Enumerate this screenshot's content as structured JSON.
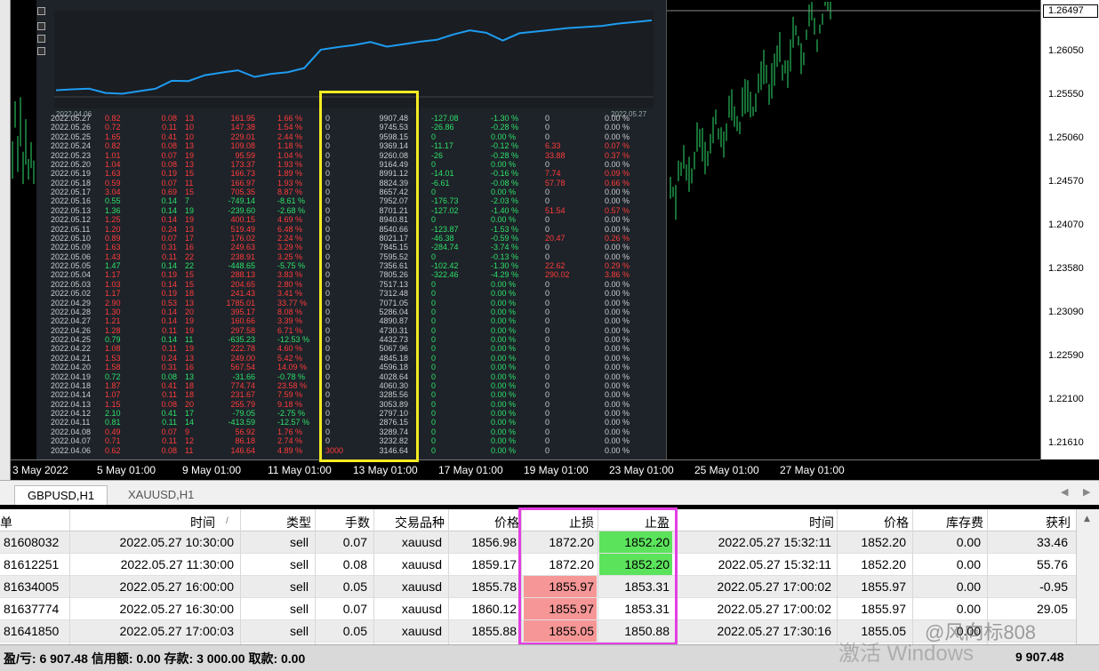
{
  "price_axis": {
    "current": "1.26497",
    "ticks": [
      "1.26050",
      "1.25550",
      "1.25060",
      "1.24570",
      "1.24070",
      "1.23580",
      "1.23090",
      "1.22590",
      "1.22100",
      "1.21610"
    ]
  },
  "time_axis": {
    "ticks": [
      "3 May 2022",
      "5 May 01:00",
      "9 May 01:00",
      "11 May 01:00",
      "13 May 01:00",
      "17 May 01:00",
      "19 May 01:00",
      "23 May 01:00",
      "25 May 01:00",
      "27 May 01:00"
    ]
  },
  "report": {
    "equity_start_date": "2022.04.06",
    "equity_end_date": "2022.05.27",
    "rows": [
      {
        "date": "2022.05.27",
        "a": "0.82",
        "b": "0.08",
        "c": "13",
        "d": "161.95",
        "e": "1.66 %",
        "f": "0",
        "g": "9907.48",
        "h": "-127.08",
        "i": "-1.30 %",
        "j": "0",
        "k": "0.00 %",
        "pos": false
      },
      {
        "date": "2022.05.26",
        "a": "0.72",
        "b": "0.11",
        "c": "10",
        "d": "147.38",
        "e": "1.54 %",
        "f": "0",
        "g": "9745.53",
        "h": "-26.86",
        "i": "-0.28 %",
        "j": "0",
        "k": "0.00 %",
        "pos": false
      },
      {
        "date": "2022.05.25",
        "a": "1.65",
        "b": "0.41",
        "c": "10",
        "d": "229.01",
        "e": "2.44 %",
        "f": "0",
        "g": "9598.15",
        "h": "0",
        "i": "0.00 %",
        "j": "0",
        "k": "0.00 %",
        "pos": false
      },
      {
        "date": "2022.05.24",
        "a": "0.82",
        "b": "0.08",
        "c": "13",
        "d": "109.08",
        "e": "1.18 %",
        "f": "0",
        "g": "9369.14",
        "h": "-11.17",
        "i": "-0.12 %",
        "j": "6.33",
        "k": "0.07 %",
        "pos": false
      },
      {
        "date": "2022.05.23",
        "a": "1.01",
        "b": "0.07",
        "c": "19",
        "d": "95.59",
        "e": "1.04 %",
        "f": "0",
        "g": "9260.08",
        "h": "-26",
        "i": "-0.28 %",
        "j": "33.88",
        "k": "0.37 %",
        "pos": false
      },
      {
        "date": "2022.05.20",
        "a": "1.04",
        "b": "0.08",
        "c": "13",
        "d": "173.37",
        "e": "1.93 %",
        "f": "0",
        "g": "9164.49",
        "h": "0",
        "i": "0.00 %",
        "j": "0",
        "k": "0.00 %",
        "pos": false
      },
      {
        "date": "2022.05.19",
        "a": "1.63",
        "b": "0.19",
        "c": "15",
        "d": "166.73",
        "e": "1.89 %",
        "f": "0",
        "g": "8991.12",
        "h": "-14.01",
        "i": "-0.16 %",
        "j": "7.74",
        "k": "0.09 %",
        "pos": false
      },
      {
        "date": "2022.05.18",
        "a": "0.59",
        "b": "0.07",
        "c": "11",
        "d": "166.97",
        "e": "1.93 %",
        "f": "0",
        "g": "8824.39",
        "h": "-6.61",
        "i": "-0.08 %",
        "j": "57.78",
        "k": "0.66 %",
        "pos": false
      },
      {
        "date": "2022.05.17",
        "a": "3.04",
        "b": "0.69",
        "c": "15",
        "d": "705.35",
        "e": "8.87 %",
        "f": "0",
        "g": "8657.42",
        "h": "0",
        "i": "0.00 %",
        "j": "0",
        "k": "0.00 %",
        "pos": false
      },
      {
        "date": "2022.05.16",
        "a": "0.55",
        "b": "0.14",
        "c": "7",
        "d": "-749.14",
        "e": "-8.61 %",
        "f": "0",
        "g": "7952.07",
        "h": "-176.73",
        "i": "-2.03 %",
        "j": "0",
        "k": "0.00 %",
        "pos": true
      },
      {
        "date": "2022.05.13",
        "a": "1.36",
        "b": "0.14",
        "c": "19",
        "d": "-239.60",
        "e": "-2.68 %",
        "f": "0",
        "g": "8701.21",
        "h": "-127.02",
        "i": "-1.40 %",
        "j": "51.54",
        "k": "0.57 %",
        "pos": true
      },
      {
        "date": "2022.05.12",
        "a": "1.25",
        "b": "0.14",
        "c": "19",
        "d": "400.15",
        "e": "4.69 %",
        "f": "0",
        "g": "8940.81",
        "h": "0",
        "i": "0.00 %",
        "j": "0",
        "k": "0.00 %",
        "pos": false
      },
      {
        "date": "2022.05.11",
        "a": "1.20",
        "b": "0.24",
        "c": "13",
        "d": "519.49",
        "e": "6.48 %",
        "f": "0",
        "g": "8540.66",
        "h": "-123.87",
        "i": "-1.53 %",
        "j": "0",
        "k": "0.00 %",
        "pos": false
      },
      {
        "date": "2022.05.10",
        "a": "0.89",
        "b": "0.07",
        "c": "17",
        "d": "176.02",
        "e": "2.24 %",
        "f": "0",
        "g": "8021.17",
        "h": "-46.38",
        "i": "-0.59 %",
        "j": "20.47",
        "k": "0.26 %",
        "pos": false
      },
      {
        "date": "2022.05.09",
        "a": "1.63",
        "b": "0.31",
        "c": "16",
        "d": "249.63",
        "e": "3.29 %",
        "f": "0",
        "g": "7845.15",
        "h": "-284.74",
        "i": "-3.74 %",
        "j": "0",
        "k": "0.00 %",
        "pos": false
      },
      {
        "date": "2022.05.06",
        "a": "1.43",
        "b": "0.11",
        "c": "22",
        "d": "238.91",
        "e": "3.25 %",
        "f": "0",
        "g": "7595.52",
        "h": "0",
        "i": "-0.13 %",
        "j": "0",
        "k": "0.00 %",
        "pos": false
      },
      {
        "date": "2022.05.05",
        "a": "1.47",
        "b": "0.14",
        "c": "22",
        "d": "-448.65",
        "e": "-5.75 %",
        "f": "0",
        "g": "7356.61",
        "h": "-102.42",
        "i": "-1.30 %",
        "j": "22.62",
        "k": "0.29 %",
        "pos": true
      },
      {
        "date": "2022.05.04",
        "a": "1.17",
        "b": "0.19",
        "c": "15",
        "d": "288.13",
        "e": "3.83 %",
        "f": "0",
        "g": "7805.26",
        "h": "-322.46",
        "i": "-4.29 %",
        "j": "290.02",
        "k": "3.86 %",
        "pos": false
      },
      {
        "date": "2022.05.03",
        "a": "1.03",
        "b": "0.14",
        "c": "15",
        "d": "204.65",
        "e": "2.80 %",
        "f": "0",
        "g": "7517.13",
        "h": "0",
        "i": "0.00 %",
        "j": "0",
        "k": "0.00 %",
        "pos": false
      },
      {
        "date": "2022.05.02",
        "a": "1.17",
        "b": "0.19",
        "c": "18",
        "d": "241.43",
        "e": "3.41 %",
        "f": "0",
        "g": "7312.48",
        "h": "0",
        "i": "0.00 %",
        "j": "0",
        "k": "0.00 %",
        "pos": false
      },
      {
        "date": "2022.04.29",
        "a": "2.90",
        "b": "0.53",
        "c": "13",
        "d": "1785.01",
        "e": "33.77 %",
        "f": "0",
        "g": "7071.05",
        "h": "0",
        "i": "0.00 %",
        "j": "0",
        "k": "0.00 %",
        "pos": false
      },
      {
        "date": "2022.04.28",
        "a": "1.30",
        "b": "0.14",
        "c": "20",
        "d": "395.17",
        "e": "8.08 %",
        "f": "0",
        "g": "5286.04",
        "h": "0",
        "i": "0.00 %",
        "j": "0",
        "k": "0.00 %",
        "pos": false
      },
      {
        "date": "2022.04.27",
        "a": "1.21",
        "b": "0.14",
        "c": "19",
        "d": "160.66",
        "e": "3.39 %",
        "f": "0",
        "g": "4890.87",
        "h": "0",
        "i": "0.00 %",
        "j": "0",
        "k": "0.00 %",
        "pos": false
      },
      {
        "date": "2022.04.26",
        "a": "1.28",
        "b": "0.11",
        "c": "19",
        "d": "297.58",
        "e": "6.71 %",
        "f": "0",
        "g": "4730.31",
        "h": "0",
        "i": "0.00 %",
        "j": "0",
        "k": "0.00 %",
        "pos": false
      },
      {
        "date": "2022.04.25",
        "a": "0.79",
        "b": "0.14",
        "c": "11",
        "d": "-635.23",
        "e": "-12.53 %",
        "f": "0",
        "g": "4432.73",
        "h": "0",
        "i": "0.00 %",
        "j": "0",
        "k": "0.00 %",
        "pos": true
      },
      {
        "date": "2022.04.22",
        "a": "1.08",
        "b": "0.11",
        "c": "19",
        "d": "222.78",
        "e": "4.60 %",
        "f": "0",
        "g": "5067.96",
        "h": "0",
        "i": "0.00 %",
        "j": "0",
        "k": "0.00 %",
        "pos": false
      },
      {
        "date": "2022.04.21",
        "a": "1.53",
        "b": "0.24",
        "c": "13",
        "d": "249.00",
        "e": "5.42 %",
        "f": "0",
        "g": "4845.18",
        "h": "0",
        "i": "0.00 %",
        "j": "0",
        "k": "0.00 %",
        "pos": false
      },
      {
        "date": "2022.04.20",
        "a": "1.58",
        "b": "0.31",
        "c": "16",
        "d": "567.54",
        "e": "14.09 %",
        "f": "0",
        "g": "4596.18",
        "h": "0",
        "i": "0.00 %",
        "j": "0",
        "k": "0.00 %",
        "pos": false
      },
      {
        "date": "2022.04.19",
        "a": "0.72",
        "b": "0.08",
        "c": "13",
        "d": "-31.66",
        "e": "-0.78 %",
        "f": "0",
        "g": "4028.64",
        "h": "0",
        "i": "0.00 %",
        "j": "0",
        "k": "0.00 %",
        "pos": true
      },
      {
        "date": "2022.04.18",
        "a": "1.87",
        "b": "0.41",
        "c": "18",
        "d": "774.74",
        "e": "23.58 %",
        "f": "0",
        "g": "4060.30",
        "h": "0",
        "i": "0.00 %",
        "j": "0",
        "k": "0.00 %",
        "pos": false
      },
      {
        "date": "2022.04.14",
        "a": "1.07",
        "b": "0.11",
        "c": "18",
        "d": "231.67",
        "e": "7.59 %",
        "f": "0",
        "g": "3285.56",
        "h": "0",
        "i": "0.00 %",
        "j": "0",
        "k": "0.00 %",
        "pos": false
      },
      {
        "date": "2022.04.13",
        "a": "1.15",
        "b": "0.08",
        "c": "20",
        "d": "255.79",
        "e": "9.18 %",
        "f": "0",
        "g": "3053.89",
        "h": "0",
        "i": "0.00 %",
        "j": "0",
        "k": "0.00 %",
        "pos": false
      },
      {
        "date": "2022.04.12",
        "a": "2.10",
        "b": "0.41",
        "c": "17",
        "d": "-79.05",
        "e": "-2.75 %",
        "f": "0",
        "g": "2797.10",
        "h": "0",
        "i": "0.00 %",
        "j": "0",
        "k": "0.00 %",
        "pos": true
      },
      {
        "date": "2022.04.11",
        "a": "0.81",
        "b": "0.11",
        "c": "14",
        "d": "-413.59",
        "e": "-12.57 %",
        "f": "0",
        "g": "2876.15",
        "h": "0",
        "i": "0.00 %",
        "j": "0",
        "k": "0.00 %",
        "pos": true
      },
      {
        "date": "2022.04.08",
        "a": "0.49",
        "b": "0.07",
        "c": "9",
        "d": "56.92",
        "e": "1.76 %",
        "f": "0",
        "g": "3289.74",
        "h": "0",
        "i": "0.00 %",
        "j": "0",
        "k": "0.00 %",
        "pos": false
      },
      {
        "date": "2022.04.07",
        "a": "0.71",
        "b": "0.11",
        "c": "12",
        "d": "86.18",
        "e": "2.74 %",
        "f": "0",
        "g": "3232.82",
        "h": "0",
        "i": "0.00 %",
        "j": "0",
        "k": "0.00 %",
        "pos": false
      },
      {
        "date": "2022.04.06",
        "a": "0.62",
        "b": "0.08",
        "c": "11",
        "d": "146.64",
        "e": "4.89 %",
        "f": "3000",
        "g": "3146.64",
        "h": "0",
        "i": "0.00 %",
        "j": "0",
        "k": "0.00 %",
        "pos": false
      }
    ]
  },
  "tabs": [
    {
      "label": "GBPUSD,H1",
      "active": true
    },
    {
      "label": "XAUUSD,H1",
      "active": false
    }
  ],
  "grid": {
    "headers": {
      "order": "单",
      "open_time": "时间",
      "sort_mark": "/",
      "type": "类型",
      "volume": "手数",
      "symbol": "交易品种",
      "open_price": "价格",
      "sl": "止损",
      "tp": "止盈",
      "close_time": "时间",
      "close_price": "价格",
      "swap": "库存费",
      "profit": "获利"
    },
    "rows": [
      {
        "order": "81608032",
        "open_time": "2022.05.27 10:30:00",
        "type": "sell",
        "volume": "0.07",
        "symbol": "xauusd",
        "open_price": "1856.98",
        "sl": "1872.20",
        "tp": "1852.20",
        "close_time": "2022.05.27 15:32:11",
        "close_price": "1852.20",
        "swap": "0.00",
        "profit": "33.46",
        "sl_hl": "none",
        "tp_hl": "green"
      },
      {
        "order": "81612251",
        "open_time": "2022.05.27 11:30:00",
        "type": "sell",
        "volume": "0.08",
        "symbol": "xauusd",
        "open_price": "1859.17",
        "sl": "1872.20",
        "tp": "1852.20",
        "close_time": "2022.05.27 15:32:11",
        "close_price": "1852.20",
        "swap": "0.00",
        "profit": "55.76",
        "sl_hl": "none",
        "tp_hl": "green"
      },
      {
        "order": "81634005",
        "open_time": "2022.05.27 16:00:00",
        "type": "sell",
        "volume": "0.05",
        "symbol": "xauusd",
        "open_price": "1855.78",
        "sl": "1855.97",
        "tp": "1853.31",
        "close_time": "2022.05.27 17:00:02",
        "close_price": "1855.97",
        "swap": "0.00",
        "profit": "-0.95",
        "sl_hl": "red",
        "tp_hl": "none"
      },
      {
        "order": "81637774",
        "open_time": "2022.05.27 16:30:00",
        "type": "sell",
        "volume": "0.07",
        "symbol": "xauusd",
        "open_price": "1860.12",
        "sl": "1855.97",
        "tp": "1853.31",
        "close_time": "2022.05.27 17:00:02",
        "close_price": "1855.97",
        "swap": "0.00",
        "profit": "29.05",
        "sl_hl": "red",
        "tp_hl": "none"
      },
      {
        "order": "81641850",
        "open_time": "2022.05.27 17:00:03",
        "type": "sell",
        "volume": "0.05",
        "symbol": "xauusd",
        "open_price": "1855.88",
        "sl": "1855.05",
        "tp": "1850.88",
        "close_time": "2022.05.27 17:30:16",
        "close_price": "1855.05",
        "swap": "0.00",
        "profit": "",
        "sl_hl": "red",
        "tp_hl": "none"
      }
    ]
  },
  "status": {
    "summary": "盈/亏: 6 907.48  信用额: 0.00  存款: 3 000.00  取款: 0.00",
    "total": "9 907.48"
  },
  "watermark": {
    "activate": "激活 Windows",
    "author": "@风向标808"
  },
  "colors": {
    "report_bg": "#1e2329",
    "equity_line": "#1e9cf0",
    "candle_green": "#2ee06a",
    "gain_red": "#ff3b3b",
    "highlight_yellow": "#f6ec22",
    "highlight_magenta": "#e33ee3",
    "cell_red": "#f69696",
    "cell_green": "#5ce35c"
  }
}
